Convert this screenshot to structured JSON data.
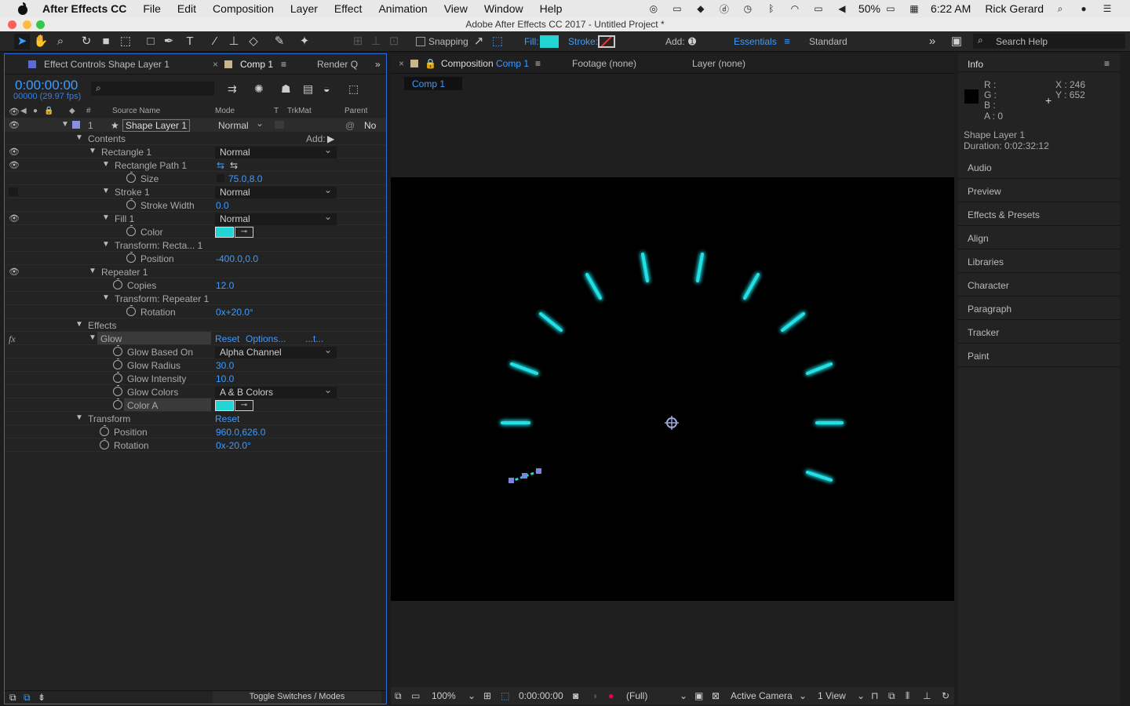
{
  "menubar": {
    "app_name": "After Effects CC",
    "items": [
      "File",
      "Edit",
      "Composition",
      "Layer",
      "Effect",
      "Animation",
      "View",
      "Window",
      "Help"
    ],
    "battery": "50%",
    "time": "6:22 AM",
    "user": "Rick Gerard"
  },
  "window_title": "Adobe After Effects CC 2017 - Untitled Project *",
  "toolbar": {
    "snapping": "Snapping",
    "fill": "Fill:",
    "stroke": "Stroke:",
    "add": "Add:",
    "workspace_active": "Essentials",
    "workspace_other": "Standard",
    "search_placeholder": "Search Help",
    "fill_color": "#22d4d4"
  },
  "left_panel": {
    "tab_effect_controls": "Effect Controls Shape Layer 1",
    "tab_comp": "Comp 1",
    "tab_render": "Render Q",
    "timecode": "0:00:00:00",
    "frames": "00000 (29.97 fps)",
    "col_source": "Source Name",
    "col_mode": "Mode",
    "col_t": "T",
    "col_trkmat": "TrkMat",
    "col_parent": "Parent",
    "layer": {
      "num": "1",
      "name": "Shape Layer 1",
      "mode": "Normal",
      "parent": "No"
    },
    "contents": "Contents",
    "add": "Add:",
    "rectangle": "Rectangle 1",
    "rectangle_mode": "Normal",
    "rect_path": "Rectangle Path 1",
    "size_label": "Size",
    "size_val": "75.0,8.0",
    "stroke": "Stroke 1",
    "stroke_mode": "Normal",
    "stroke_width_label": "Stroke Width",
    "stroke_width_val": "0.0",
    "fill": "Fill 1",
    "fill_mode": "Normal",
    "color_label": "Color",
    "transform_rect": "Transform: Recta... 1",
    "position_label": "Position",
    "position_val": "-400.0,0.0",
    "repeater": "Repeater 1",
    "copies_label": "Copies",
    "copies_val": "12.0",
    "transform_rep": "Transform: Repeater 1",
    "rotation_label": "Rotation",
    "rotation_val": "0x+20.0°",
    "effects": "Effects",
    "glow": "Glow",
    "reset": "Reset",
    "options": "Options...",
    "about": "...t...",
    "glow_based_label": "Glow Based On",
    "glow_based_val": "Alpha Channel",
    "glow_radius_label": "Glow Radius",
    "glow_radius_val": "30.0",
    "glow_intensity_label": "Glow Intensity",
    "glow_intensity_val": "10.0",
    "glow_colors_label": "Glow Colors",
    "glow_colors_val": "A & B Colors",
    "color_a_label": "Color A",
    "transform": "Transform",
    "transform_reset": "Reset",
    "tr_position_label": "Position",
    "tr_position_val": "960.0,626.0",
    "tr_rotation_label": "Rotation",
    "tr_rotation_val": "0x-20.0°",
    "toggle": "Toggle Switches / Modes"
  },
  "mid_panel": {
    "tab_comp_prefix": "Composition",
    "tab_comp_name": "Comp 1",
    "tab_footage": "Footage (none)",
    "tab_layer": "Layer (none)",
    "comp_btn": "Comp 1",
    "zoom": "100%",
    "timecode": "0:00:00:00",
    "resolution": "(Full)",
    "camera": "Active Camera",
    "views": "1 View"
  },
  "right_panel": {
    "info_title": "Info",
    "r": "R :",
    "g": "G :",
    "b": "B :",
    "a": "A : 0",
    "x": "X : 246",
    "y": "Y : 652",
    "layer_name": "Shape Layer 1",
    "duration": "Duration: 0:02:32:12",
    "items": [
      "Audio",
      "Preview",
      "Effects & Presets",
      "Align",
      "Libraries",
      "Character",
      "Paragraph",
      "Tracker",
      "Paint"
    ]
  },
  "colors": {
    "accent": "#3d9bff",
    "cyan": "#22d4d4",
    "panel_border": "#2d6de0"
  }
}
